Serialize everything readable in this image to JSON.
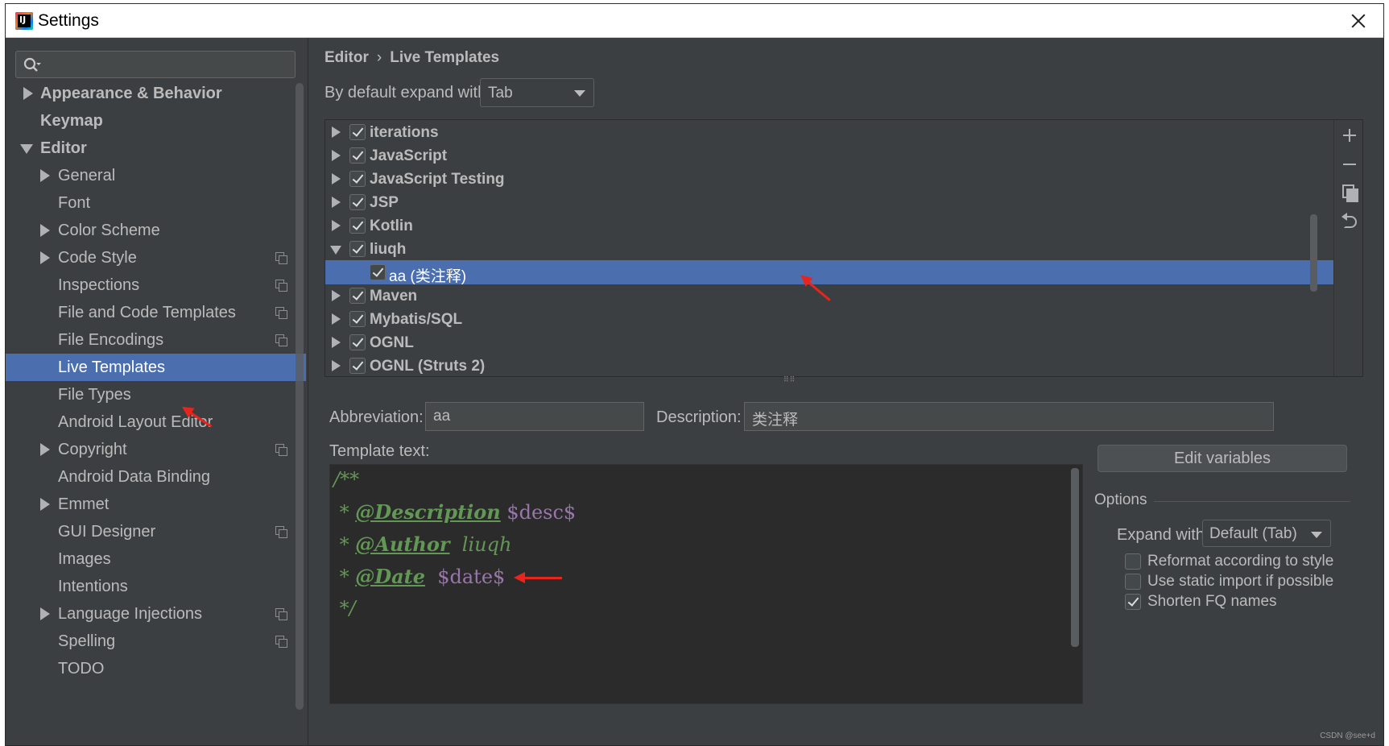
{
  "window": {
    "title": "Settings"
  },
  "search": {
    "placeholder": ""
  },
  "sidebar": {
    "items": [
      {
        "label": "Appearance & Behavior"
      },
      {
        "label": "Keymap"
      },
      {
        "label": "Editor"
      },
      {
        "label": "General"
      },
      {
        "label": "Font"
      },
      {
        "label": "Color Scheme"
      },
      {
        "label": "Code Style"
      },
      {
        "label": "Inspections"
      },
      {
        "label": "File and Code Templates"
      },
      {
        "label": "File Encodings"
      },
      {
        "label": "Live Templates"
      },
      {
        "label": "File Types"
      },
      {
        "label": "Android Layout Editor"
      },
      {
        "label": "Copyright"
      },
      {
        "label": "Android Data Binding"
      },
      {
        "label": "Emmet"
      },
      {
        "label": "GUI Designer"
      },
      {
        "label": "Images"
      },
      {
        "label": "Intentions"
      },
      {
        "label": "Language Injections"
      },
      {
        "label": "Spelling"
      },
      {
        "label": "TODO"
      }
    ],
    "selected": "Live Templates"
  },
  "breadcrumb": {
    "parent": "Editor",
    "separator": "›",
    "current": "Live Templates"
  },
  "expand_default": {
    "label": "By default expand with",
    "value": "Tab"
  },
  "templates": {
    "groups": [
      {
        "label": "iterations",
        "checked": true
      },
      {
        "label": "JavaScript",
        "checked": true
      },
      {
        "label": "JavaScript Testing",
        "checked": true
      },
      {
        "label": "JSP",
        "checked": true
      },
      {
        "label": "Kotlin",
        "checked": true
      },
      {
        "label": "liuqh",
        "checked": true
      },
      {
        "label": "aa (类注释)",
        "checked": true
      },
      {
        "label": "Maven",
        "checked": true
      },
      {
        "label": "Mybatis/SQL",
        "checked": true
      },
      {
        "label": "OGNL",
        "checked": true
      },
      {
        "label": "OGNL (Struts 2)",
        "checked": true
      }
    ]
  },
  "splitter": {
    "grip": "⠿⠿"
  },
  "fields": {
    "abbreviation_label": "Abbreviation:",
    "abbreviation_value": "aa",
    "description_label": "Description:",
    "description_value": "类注释",
    "template_text_label": "Template text:"
  },
  "editor": {
    "line1": "/**",
    "line2_star": " * ",
    "line2_tag": "@Description",
    "line2_var": " $desc$",
    "line3_star": " * ",
    "line3_tag": "@Author",
    "line3_text": "  liuqh",
    "line4_star": " * ",
    "line4_tag": "@Date",
    "line4_var": "  $date$",
    "line5": " */"
  },
  "options": {
    "edit_variables": "Edit variables",
    "title": "Options",
    "expand_with_label": "Expand with",
    "expand_with_value": "Default (Tab)",
    "reformat_label": "Reformat according to style",
    "reformat_checked": false,
    "static_import_label": "Use static import if possible",
    "static_import_checked": false,
    "shorten_label": "Shorten FQ names",
    "shorten_checked": true
  },
  "watermark": "CSDN @see+d",
  "colors": {
    "background": "#3c3f41",
    "selection": "#4b6eaf",
    "editor_bg": "#2b2b2b",
    "doc_comment": "#629755",
    "template_var": "#9876aa",
    "annotation_arrow": "#e8251c"
  }
}
